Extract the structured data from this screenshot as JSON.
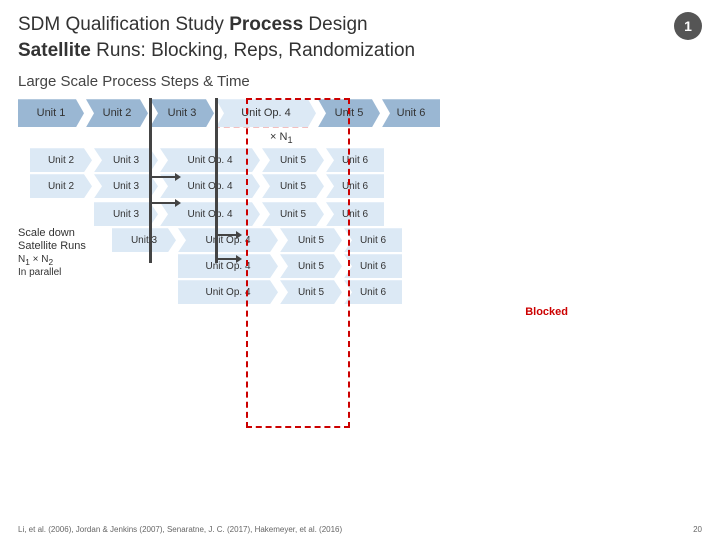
{
  "header": {
    "title_part1": "SDM Qualification Study ",
    "title_bold1": "Process",
    "title_part2": " Design",
    "title_line2_part1": "",
    "title_bold2": "Satellite",
    "title_line2_part2": " Runs: Blocking, Reps, Randomization",
    "slide_number": "1"
  },
  "section": {
    "title": "Large Scale Process Steps & Time"
  },
  "columns": {
    "unit1": "Unit 1",
    "unit2": "Unit 2",
    "unit3": "Unit 3",
    "unitop4": "Unit Op. 4",
    "unit5": "Unit 5",
    "unit6": "Unit 6"
  },
  "labels": {
    "times_n1": "× N",
    "n1_sub": "1",
    "n1_x_n2": "N",
    "n1_sub2": "1",
    "x_sym": "×",
    "n2": "N",
    "n2_sub": "2",
    "in_parallel": "In parallel",
    "blocked": "Blocked",
    "scale_down": "Scale down",
    "satellite_runs": "Satellite Runs"
  },
  "footer": {
    "citation": "Li, et al. (2006), Jordan & Jenkins (2007), Senaratne, J. C. (2017), Hakemeyer, et al. (2016)",
    "page": "20"
  },
  "rows": [
    {
      "type": "main",
      "cells": [
        "Unit 1",
        "Unit 2",
        "Unit 3",
        "Unit Op. 4",
        "Unit 5",
        "Unit 6"
      ]
    },
    {
      "type": "sub",
      "indent": 1,
      "cells": [
        "Unit 2",
        "Unit 3",
        "Unit Op. 4",
        "Unit 5",
        "Unit 6"
      ]
    },
    {
      "type": "sub",
      "indent": 1,
      "cells": [
        "Unit 2",
        "Unit 3",
        "Unit Op. 4",
        "Unit 5",
        "Unit 6"
      ]
    },
    {
      "type": "sub",
      "indent": 2,
      "cells": [
        "Unit 3",
        "Unit Op. 4",
        "Unit 5",
        "Unit 6"
      ]
    },
    {
      "type": "sub",
      "indent": 2,
      "cells": [
        "Unit 3",
        "Unit Op. 4",
        "Unit 5",
        "Unit 6"
      ]
    },
    {
      "type": "sub",
      "indent": 3,
      "cells": [
        "Unit Op. 4",
        "Unit 5",
        "Unit 6"
      ]
    },
    {
      "type": "sub",
      "indent": 3,
      "cells": [
        "Unit Op. 4",
        "Unit 5",
        "Unit 6"
      ]
    }
  ]
}
